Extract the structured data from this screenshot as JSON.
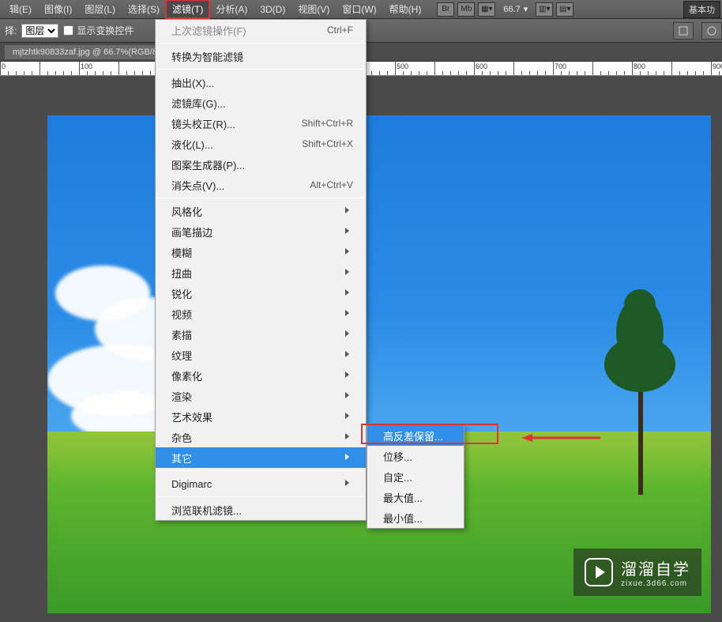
{
  "menubar": {
    "items": [
      "辑(E)",
      "图像(I)",
      "图层(L)",
      "选择(S)",
      "滤镜(T)",
      "分析(A)",
      "3D(D)",
      "视图(V)",
      "窗口(W)",
      "帮助(H)"
    ],
    "active_index": 4,
    "toolbar_icons": [
      "Br",
      "Mb"
    ],
    "zoom_text": "66.7",
    "right_button": "基本功"
  },
  "optbar": {
    "label": "择:",
    "select_value": "图层",
    "checkbox_label": "显示变换控件"
  },
  "doc_tab": "mjtzhtk90833zaf.jpg @ 66.7%(RGB/8",
  "filter_menu": {
    "last_label": "上次滤镜操作(F)",
    "last_shortcut": "Ctrl+F",
    "smart_label": "转换为智能滤镜",
    "group2": [
      {
        "label": "抽出(X)...",
        "sc": ""
      },
      {
        "label": "滤镜库(G)...",
        "sc": ""
      },
      {
        "label": "镜头校正(R)...",
        "sc": "Shift+Ctrl+R"
      },
      {
        "label": "液化(L)...",
        "sc": "Shift+Ctrl+X"
      },
      {
        "label": "图案生成器(P)...",
        "sc": ""
      },
      {
        "label": "消失点(V)...",
        "sc": "Alt+Ctrl+V"
      }
    ],
    "group3": [
      "风格化",
      "画笔描边",
      "模糊",
      "扭曲",
      "锐化",
      "视频",
      "素描",
      "纹理",
      "像素化",
      "渲染",
      "艺术效果",
      "杂色",
      "其它"
    ],
    "active_group3_index": 12,
    "digimarc": "Digimarc",
    "browse": "浏览联机滤镜..."
  },
  "other_submenu": {
    "items": [
      "高反差保留...",
      "位移...",
      "自定...",
      "最大值...",
      "最小值..."
    ],
    "active_index": 0
  },
  "watermark": {
    "title": "溜溜自学",
    "sub": "zixue.3d66.com"
  }
}
